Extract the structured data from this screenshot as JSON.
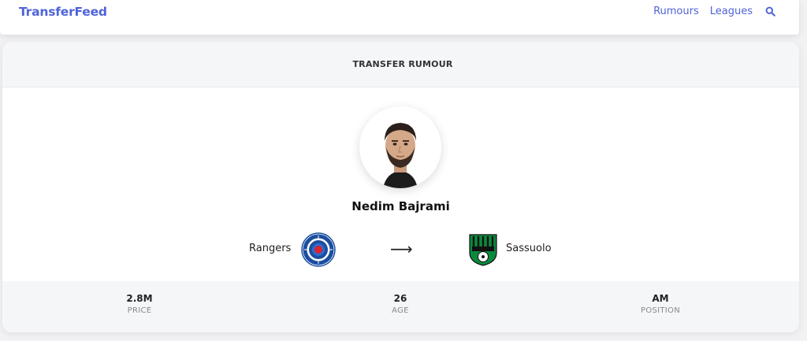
{
  "brand": "TransferFeed",
  "nav": {
    "rumours": "Rumours",
    "leagues": "Leagues",
    "search_icon": "search-icon"
  },
  "card": {
    "title": "TRANSFER RUMOUR",
    "player_name": "Nedim Bajrami",
    "from_club": "Rangers",
    "arrow": "⟶",
    "to_club": "Sassuolo",
    "stats": [
      {
        "value": "2.8M",
        "label": "PRICE"
      },
      {
        "value": "26",
        "label": "AGE"
      },
      {
        "value": "AM",
        "label": "POSITION"
      }
    ]
  },
  "colors": {
    "accent": "#4f63d8",
    "rangers_blue": "#1b4ea0",
    "sassuolo_green": "#0b8a3e"
  }
}
